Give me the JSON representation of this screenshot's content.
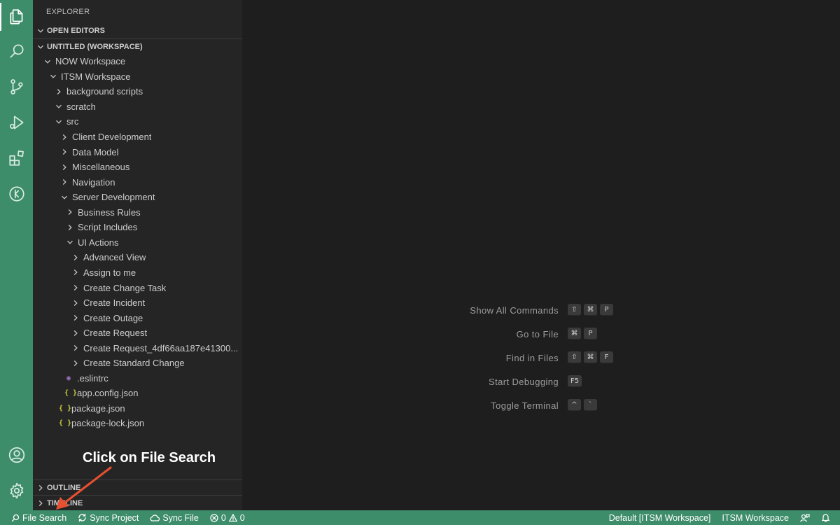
{
  "explorer": {
    "title": "EXPLORER",
    "open_editors": "OPEN EDITORS",
    "workspace": "UNTITLED (WORKSPACE)",
    "outline": "OUTLINE",
    "timeline": "TIMELINE",
    "tree": [
      {
        "label": "NOW Workspace",
        "depth": 0,
        "type": "folder",
        "expanded": true
      },
      {
        "label": "ITSM Workspace",
        "depth": 1,
        "type": "folder",
        "expanded": true
      },
      {
        "label": "background scripts",
        "depth": 2,
        "type": "folder",
        "expanded": false
      },
      {
        "label": "scratch",
        "depth": 2,
        "type": "folder",
        "expanded": true
      },
      {
        "label": "src",
        "depth": 2,
        "type": "folder",
        "expanded": true
      },
      {
        "label": "Client Development",
        "depth": 3,
        "type": "folder",
        "expanded": false
      },
      {
        "label": "Data Model",
        "depth": 3,
        "type": "folder",
        "expanded": false
      },
      {
        "label": "Miscellaneous",
        "depth": 3,
        "type": "folder",
        "expanded": false
      },
      {
        "label": "Navigation",
        "depth": 3,
        "type": "folder",
        "expanded": false
      },
      {
        "label": "Server Development",
        "depth": 3,
        "type": "folder",
        "expanded": true
      },
      {
        "label": "Business Rules",
        "depth": 4,
        "type": "folder",
        "expanded": false
      },
      {
        "label": "Script Includes",
        "depth": 4,
        "type": "folder",
        "expanded": false
      },
      {
        "label": "UI Actions",
        "depth": 4,
        "type": "folder",
        "expanded": true
      },
      {
        "label": "Advanced View",
        "depth": 5,
        "type": "folder",
        "expanded": false
      },
      {
        "label": "Assign to me",
        "depth": 5,
        "type": "folder",
        "expanded": false
      },
      {
        "label": "Create Change Task",
        "depth": 5,
        "type": "folder",
        "expanded": false
      },
      {
        "label": "Create Incident",
        "depth": 5,
        "type": "folder",
        "expanded": false
      },
      {
        "label": "Create Outage",
        "depth": 5,
        "type": "folder",
        "expanded": false
      },
      {
        "label": "Create Request",
        "depth": 5,
        "type": "folder",
        "expanded": false
      },
      {
        "label": "Create Request_4df66aa187e41300...",
        "depth": 5,
        "type": "folder",
        "expanded": false
      },
      {
        "label": "Create Standard Change",
        "depth": 5,
        "type": "folder",
        "expanded": false
      },
      {
        "label": ".eslintrc",
        "depth": 2,
        "type": "eslint"
      },
      {
        "label": "app.config.json",
        "depth": 2,
        "type": "json"
      },
      {
        "label": "package.json",
        "depth": 1,
        "type": "json"
      },
      {
        "label": "package-lock.json",
        "depth": 1,
        "type": "json"
      }
    ]
  },
  "icons": {
    "json": "{ }",
    "eslint": "◉"
  },
  "editor": {
    "shortcuts": [
      {
        "label": "Show All Commands",
        "keys": [
          "⇧",
          "⌘",
          "P"
        ]
      },
      {
        "label": "Go to File",
        "keys": [
          "⌘",
          "P"
        ]
      },
      {
        "label": "Find in Files",
        "keys": [
          "⇧",
          "⌘",
          "F"
        ]
      },
      {
        "label": "Start Debugging",
        "keys": [
          "F5"
        ]
      },
      {
        "label": "Toggle Terminal",
        "keys": [
          "^",
          "`"
        ]
      }
    ]
  },
  "annotation": {
    "text": "Click on File Search",
    "arrow_color": "#e8502f"
  },
  "status_bar": {
    "file_search": "File Search",
    "sync_project": "Sync Project",
    "sync_file": "Sync File",
    "errors": "0",
    "warnings": "0",
    "scope": "Default [ITSM Workspace]",
    "workspace": "ITSM Workspace"
  },
  "colors": {
    "accent": "#3d8c6a",
    "sidebar_bg": "#252526",
    "editor_bg": "#1e1e1e"
  }
}
